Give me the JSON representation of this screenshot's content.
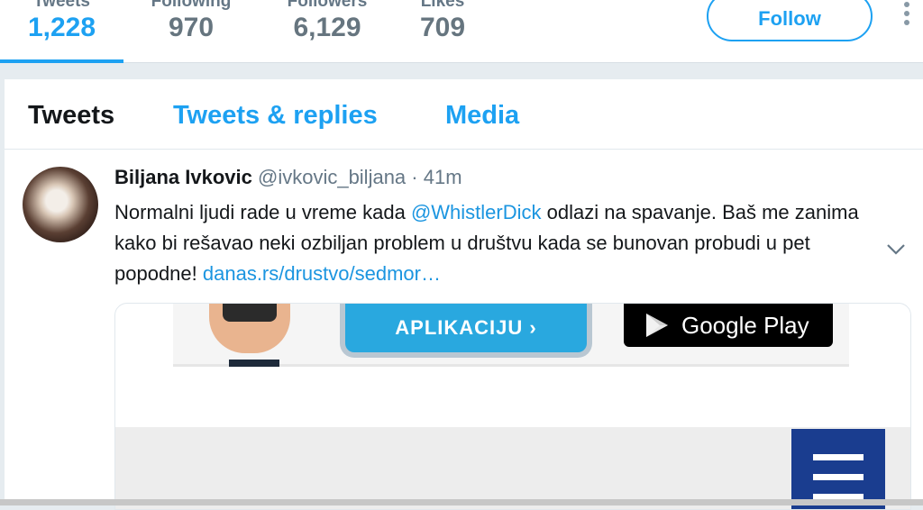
{
  "profile_nav": {
    "stats": [
      {
        "label": "Tweets",
        "value": "1,228"
      },
      {
        "label": "Following",
        "value": "970"
      },
      {
        "label": "Followers",
        "value": "6,129"
      },
      {
        "label": "Likes",
        "value": "709"
      }
    ],
    "follow_label": "Follow"
  },
  "tabs": [
    {
      "label": "Tweets"
    },
    {
      "label": "Tweets & replies"
    },
    {
      "label": "Media"
    }
  ],
  "tweet": {
    "fullname": "Biljana Ivkovic",
    "username": "@ivkovic_biljana",
    "separator": "·",
    "time": "41m",
    "text_part1": "Normalni ljudi rade u vreme kada ",
    "mention": "@WhistlerDick",
    "text_part2": " odlazi na spavanje. Baš me zanima kako bi rešavao neki ozbiljan problem u društvu  kada se bunovan probudi u pet popodne! ",
    "link": "danas.rs/drustvo/sedmor…",
    "card": {
      "app_button": "APLIKACIJU ›",
      "store_button": "Google Play"
    }
  },
  "colors": {
    "accent": "#1da1f2",
    "text": "#14171a",
    "muted": "#657786",
    "background": "#e6ecf0"
  }
}
